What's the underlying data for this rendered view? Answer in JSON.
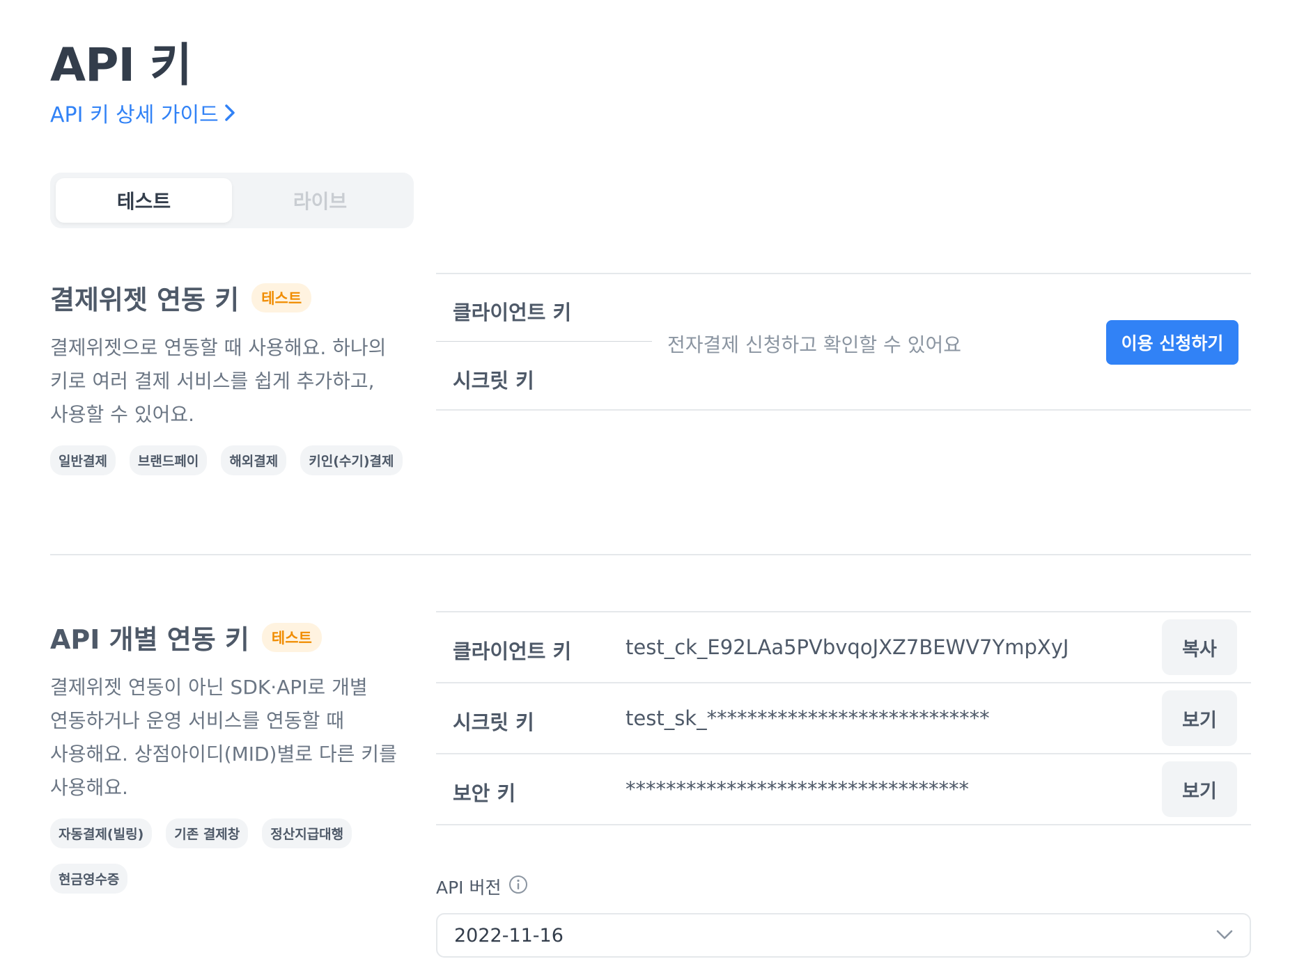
{
  "header": {
    "title": "API 키",
    "guide_link": "API 키 상세 가이드"
  },
  "mode_tabs": [
    {
      "label": "테스트",
      "active": true
    },
    {
      "label": "라이브",
      "active": false
    }
  ],
  "widget_section": {
    "title": "결제위젯 연동 키",
    "badge": "테스트",
    "desc_lines": [
      "결제위젯으로 연동할 때 사용해요. 하나의",
      "키로 여러 결제 서비스를 쉽게 추가하고,",
      "사용할 수 있어요."
    ],
    "chips": [
      "일반결제",
      "브랜드페이",
      "해외결제",
      "키인(수기)결제"
    ],
    "client_key_label": "클라이언트 키",
    "secret_key_label": "시크릿 키",
    "note": "전자결제 신청하고 확인할 수 있어요",
    "apply_button": "이용 신청하기"
  },
  "api_section": {
    "title": "API 개별 연동 키",
    "badge": "테스트",
    "desc_lines": [
      "결제위젯 연동이 아닌 SDK·API로 개별",
      "연동하거나 운영 서비스를 연동할 때",
      "사용해요. 상점아이디(MID)별로 다른 키를",
      "사용해요."
    ],
    "chips": [
      "자동결제(빌링)",
      "기존 결제창",
      "정산지급대행",
      "현금영수증"
    ],
    "rows": [
      {
        "label": "클라이언트 키",
        "value": "test_ck_E92LAa5PVbvqoJXZ7BEWV7YmpXyJ",
        "button": "복사"
      },
      {
        "label": "시크릿 키",
        "value": "test_sk_****************************",
        "button": "보기"
      },
      {
        "label": "보안 키",
        "value": "**********************************",
        "button": "보기"
      }
    ],
    "version_label": "API 버전",
    "version_value": "2022-11-16"
  },
  "colors": {
    "accent": "#3182f6",
    "badge_text": "#f08c00",
    "badge_bg": "#fff3e0",
    "chip_bg": "#f2f4f6"
  }
}
